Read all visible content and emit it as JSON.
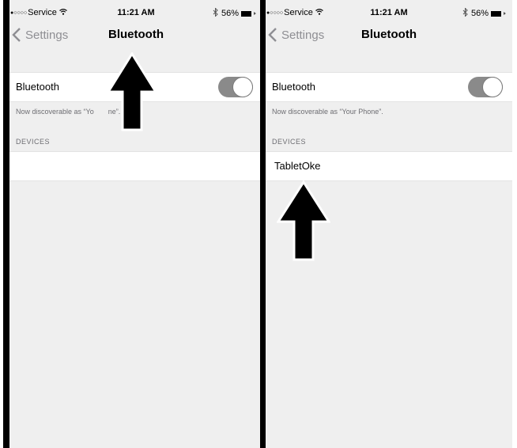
{
  "panels": [
    {
      "status_bar": {
        "signal": "●○○○○",
        "carrier": "Service",
        "time": "11:21 AM",
        "battery": "56%"
      },
      "nav": {
        "back_label": "Settings",
        "title": "Bluetooth"
      },
      "bluetooth_row": {
        "label": "Bluetooth",
        "toggle_on": true
      },
      "discoverable_text": "Now discoverable as “Yo",
      "discoverable_text_tail": "ne”.",
      "devices_header": "DEVICES",
      "devices": []
    },
    {
      "status_bar": {
        "signal": "●○○○○",
        "carrier": "Service",
        "time": "11:21 AM",
        "battery": "56%"
      },
      "nav": {
        "back_label": "Settings",
        "title": "Bluetooth"
      },
      "bluetooth_row": {
        "label": "Bluetooth",
        "toggle_on": true
      },
      "discoverable_text": "Now discoverable as “Your Phone”.",
      "devices_header": "DEVICES",
      "devices": [
        "TabletOke"
      ]
    }
  ],
  "colors": {
    "background": "#efefef",
    "toggle": "#8a8a8a",
    "arrow": "#000000"
  },
  "icons": [
    "wifi-icon",
    "bluetooth-icon",
    "battery-icon",
    "chevron-left-icon",
    "up-arrow-icon"
  ]
}
